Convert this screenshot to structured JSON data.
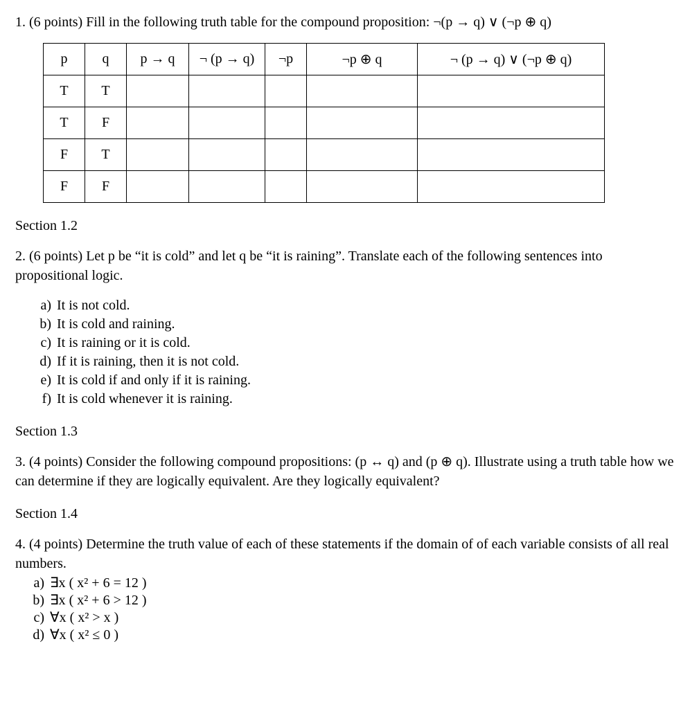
{
  "q1": {
    "prompt": "1. (6 points) Fill in the following truth table for the compound proposition: ¬(p → q) ∨ (¬p ⊕ q)",
    "headers": [
      "p",
      "q",
      "p → q",
      "¬ (p → q)",
      "¬p",
      "¬p ⊕ q",
      "¬ (p → q) ∨ (¬p ⊕ q)"
    ],
    "rows": [
      [
        "T",
        "T",
        "",
        "",
        "",
        "",
        ""
      ],
      [
        "T",
        "F",
        "",
        "",
        "",
        "",
        ""
      ],
      [
        "F",
        "T",
        "",
        "",
        "",
        "",
        ""
      ],
      [
        "F",
        "F",
        "",
        "",
        "",
        "",
        ""
      ]
    ]
  },
  "section12": "Section 1.2",
  "q2": {
    "prompt": "2. (6 points) Let p be “it is cold” and let q be “it is raining”.  Translate each of the following sentences into propositional logic.",
    "items": [
      {
        "m": "a)",
        "t": "It is not cold."
      },
      {
        "m": "b)",
        "t": "It is cold and raining."
      },
      {
        "m": "c)",
        "t": "It is raining or it is cold."
      },
      {
        "m": "d)",
        "t": "If it is raining, then it is not cold."
      },
      {
        "m": "e)",
        "t": "It is cold if and only if it is raining."
      },
      {
        "m": "f)",
        "t": "It is cold whenever it is raining."
      }
    ]
  },
  "section13": "Section 1.3",
  "q3": {
    "prompt": "3. (4 points) Consider the following compound propositions: (p ↔ q) and (p ⊕ q).  Illustrate using a truth table how we can determine if they are logically equivalent.  Are they logically equivalent?"
  },
  "section14": "Section 1.4",
  "q4": {
    "prompt": "4. (4 points) Determine the truth value of each of these statements if the domain of of each variable consists of all real numbers.",
    "items": [
      {
        "m": "a)",
        "t": "∃x ( x² + 6 = 12 )"
      },
      {
        "m": "b)",
        "t": "∃x ( x² + 6 > 12 )"
      },
      {
        "m": "c)",
        "t": "∀x ( x² > x )"
      },
      {
        "m": "d)",
        "t": "∀x ( x² ≤ 0 )"
      }
    ]
  }
}
